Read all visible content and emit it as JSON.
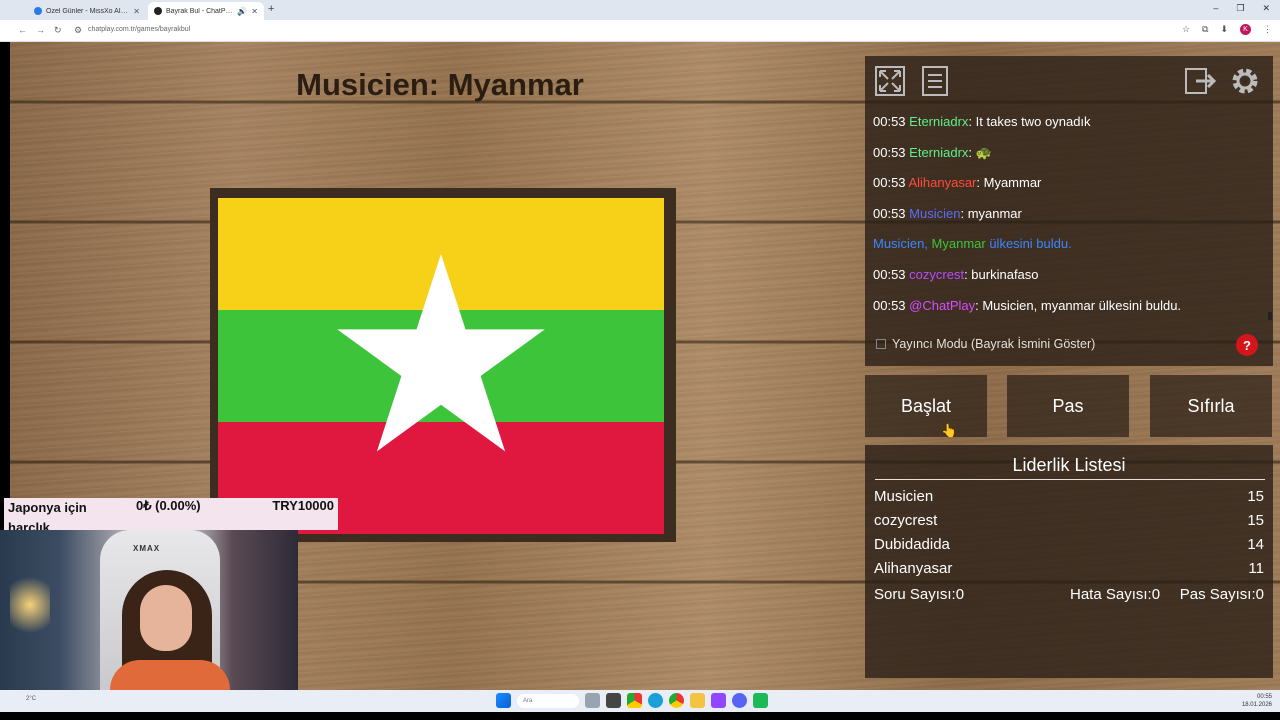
{
  "browser": {
    "tabs": [
      {
        "title": "Özel Günler - MissXo AI Bot Sy",
        "icon_color": "#2a7be4"
      },
      {
        "title": "Bayrak Bul - ChatPlay",
        "icon_color": "#222222"
      }
    ],
    "url": "chatplay.com.tr/games/bayrakbul",
    "profile_initial": "K"
  },
  "game": {
    "title": "Musicien: Myanmar",
    "flag": {
      "country": "Myanmar",
      "colors": [
        "#f7d117",
        "#3ec43b",
        "#e0173f"
      ],
      "star_color": "#ffffff"
    }
  },
  "donation": {
    "label": "Japonya için harçlık",
    "amount": "0₺ (0.00%)",
    "goal": "TRY10000"
  },
  "webcam": {
    "chair_brand": "XMAX"
  },
  "chat": {
    "messages": [
      {
        "time": "00:53",
        "user": "Eterniadrx",
        "user_color": "#5cf08a",
        "text": ": It takes two oynadık"
      },
      {
        "time": "00:53",
        "user": "Eterniadrx",
        "user_color": "#5cf08a",
        "text": ": 🐢"
      },
      {
        "time": "00:53",
        "user": "Alihanyasar",
        "user_color": "#ff4a3a",
        "text": ": Myammar"
      },
      {
        "time": "00:53",
        "user": "Musicien",
        "user_color": "#5b6bff",
        "text": ": myanmar"
      },
      {
        "time": "",
        "user": "Musicien, ",
        "user_color": "#3d86ff",
        "extra": "Myanmar",
        "extra_color": "#3ec43b",
        "text": " ülkesini buldu.",
        "text_color": "#3d86ff"
      },
      {
        "time": "00:53",
        "user": "cozycrest",
        "user_color": "#b84cff",
        "text": ": burkinafaso"
      },
      {
        "time": "00:53",
        "user": "@ChatPlay",
        "user_color": "#d64cff",
        "text": ": Musicien, myanmar ülkesini buldu."
      }
    ]
  },
  "controls": {
    "streamer_mode_label": "Yayıncı Modu (Bayrak İsmini Göster)",
    "help_label": "?",
    "start_label": "Başlat",
    "pass_label": "Pas",
    "reset_label": "Sıfırla"
  },
  "leaderboard": {
    "title": "Liderlik Listesi",
    "rows": [
      {
        "name": "Musicien",
        "score": "15"
      },
      {
        "name": "cozycrest",
        "score": "15"
      },
      {
        "name": "Dubidadida",
        "score": "14"
      },
      {
        "name": "Alihanyasar",
        "score": "11"
      }
    ],
    "question_count": "Soru Sayısı:0",
    "error_count": "Hata Sayısı:0",
    "pass_count": "Pas Sayısı:0"
  },
  "taskbar": {
    "search_placeholder": "Ara",
    "time": "00:55",
    "date": "18.01.2026",
    "weather": "2°C"
  }
}
